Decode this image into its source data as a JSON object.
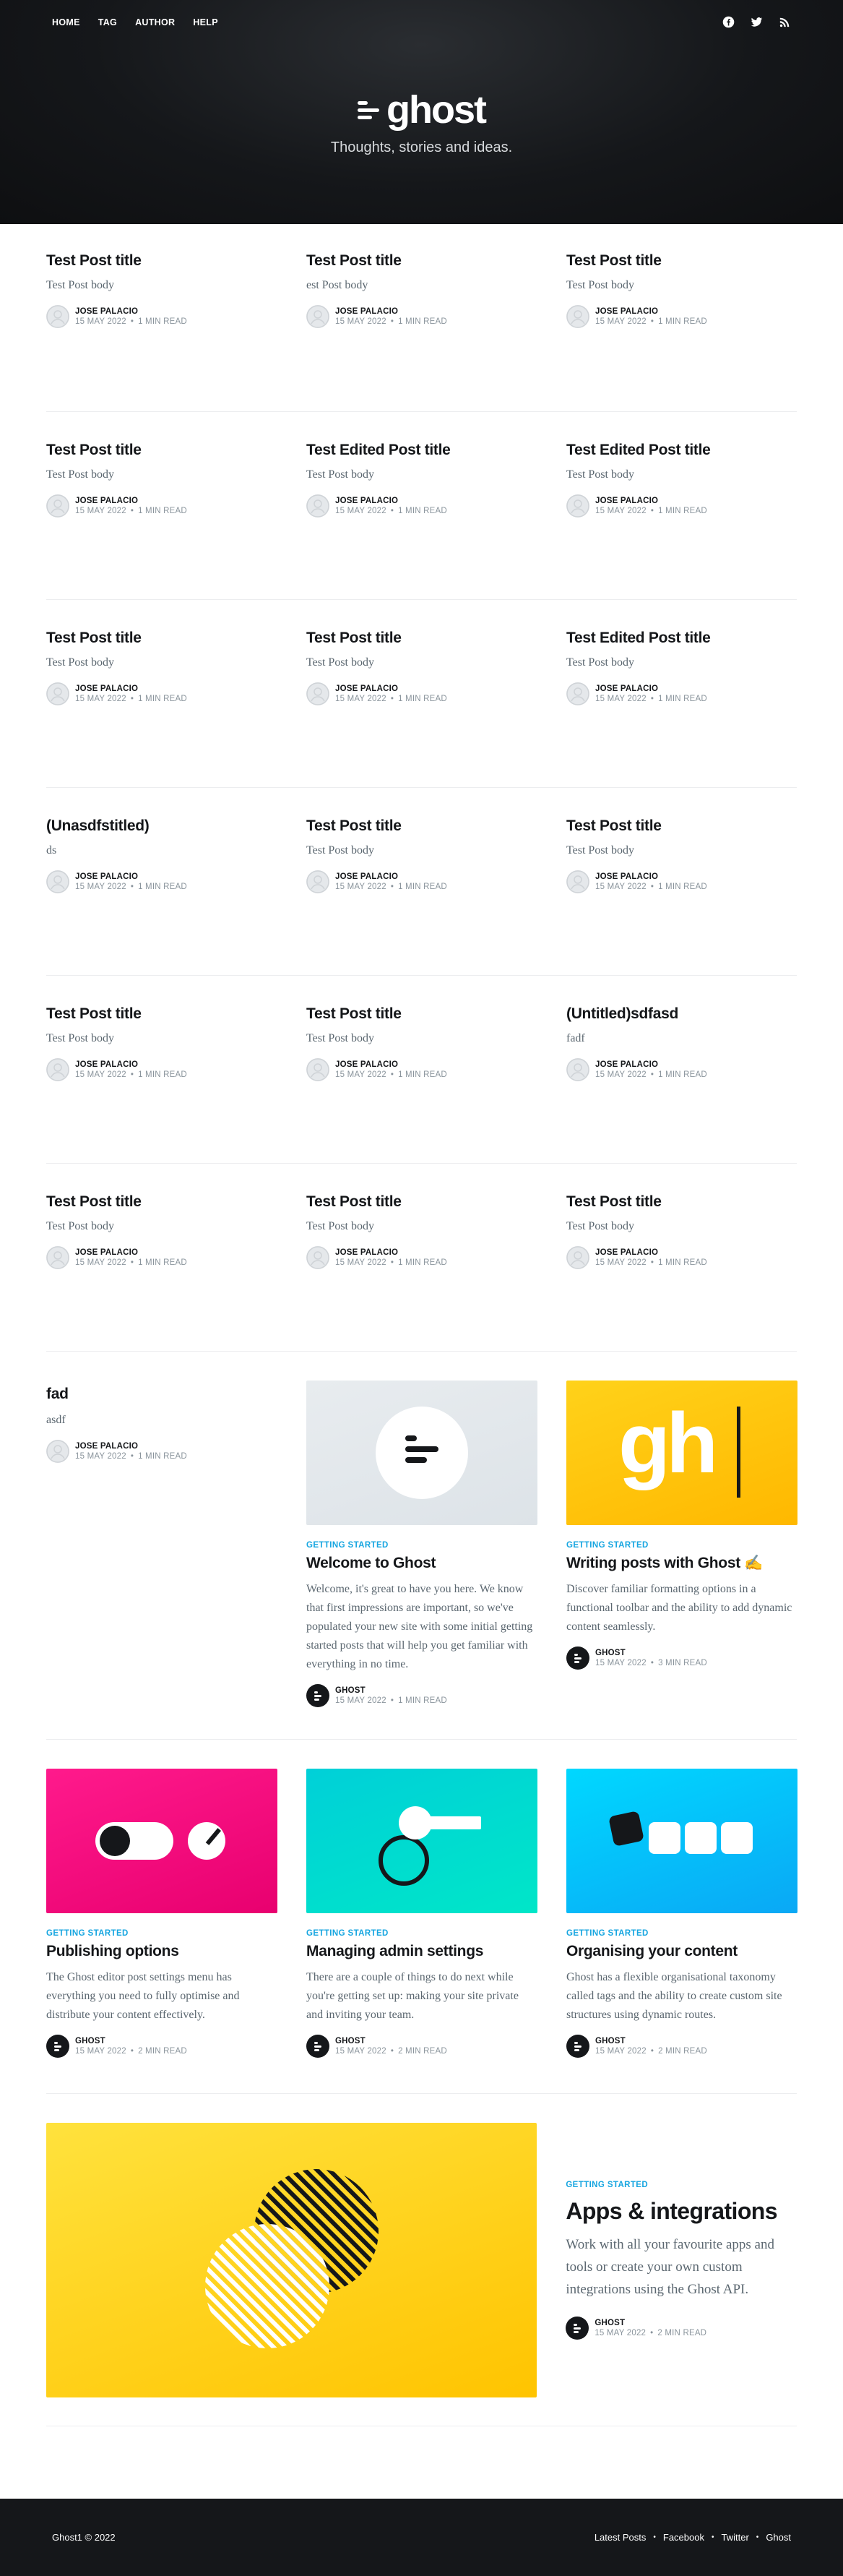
{
  "nav": {
    "links": [
      "HOME",
      "TAG",
      "AUTHOR",
      "HELP"
    ]
  },
  "brand": {
    "name": "ghost",
    "tagline": "Thoughts, stories and ideas."
  },
  "rows": [
    [
      {
        "title": "Test Post title",
        "excerpt": "Test Post body",
        "author": "JOSE PALACIO",
        "date": "15 MAY 2022",
        "read": "1 MIN READ"
      },
      {
        "title": "Test Post title",
        "excerpt": "est Post body",
        "author": "JOSE PALACIO",
        "date": "15 MAY 2022",
        "read": "1 MIN READ"
      },
      {
        "title": "Test Post title",
        "excerpt": "Test Post body",
        "author": "JOSE PALACIO",
        "date": "15 MAY 2022",
        "read": "1 MIN READ"
      }
    ],
    [
      {
        "title": "Test Post title",
        "excerpt": "Test Post body",
        "author": "JOSE PALACIO",
        "date": "15 MAY 2022",
        "read": "1 MIN READ"
      },
      {
        "title": "Test Edited Post title",
        "excerpt": "Test Post body",
        "author": "JOSE PALACIO",
        "date": "15 MAY 2022",
        "read": "1 MIN READ"
      },
      {
        "title": "Test Edited Post title",
        "excerpt": "Test Post body",
        "author": "JOSE PALACIO",
        "date": "15 MAY 2022",
        "read": "1 MIN READ"
      }
    ],
    [
      {
        "title": "Test Post title",
        "excerpt": "Test Post body",
        "author": "JOSE PALACIO",
        "date": "15 MAY 2022",
        "read": "1 MIN READ"
      },
      {
        "title": "Test Post title",
        "excerpt": "Test Post body",
        "author": "JOSE PALACIO",
        "date": "15 MAY 2022",
        "read": "1 MIN READ"
      },
      {
        "title": "Test Edited Post title",
        "excerpt": "Test Post body",
        "author": "JOSE PALACIO",
        "date": "15 MAY 2022",
        "read": "1 MIN READ"
      }
    ],
    [
      {
        "title": "(Unasdfstitled)",
        "excerpt": "ds",
        "author": "JOSE PALACIO",
        "date": "15 MAY 2022",
        "read": "1 MIN READ"
      },
      {
        "title": "Test Post title",
        "excerpt": "Test Post body",
        "author": "JOSE PALACIO",
        "date": "15 MAY 2022",
        "read": "1 MIN READ"
      },
      {
        "title": "Test Post title",
        "excerpt": "Test Post body",
        "author": "JOSE PALACIO",
        "date": "15 MAY 2022",
        "read": "1 MIN READ"
      }
    ],
    [
      {
        "title": "Test Post title",
        "excerpt": "Test Post body",
        "author": "JOSE PALACIO",
        "date": "15 MAY 2022",
        "read": "1 MIN READ"
      },
      {
        "title": "Test Post title",
        "excerpt": "Test Post body",
        "author": "JOSE PALACIO",
        "date": "15 MAY 2022",
        "read": "1 MIN READ"
      },
      {
        "title": "(Untitled)sdfasd",
        "excerpt": "fadf",
        "author": "JOSE PALACIO",
        "date": "15 MAY 2022",
        "read": "1 MIN READ"
      }
    ],
    [
      {
        "title": "Test Post title",
        "excerpt": "Test Post body",
        "author": "JOSE PALACIO",
        "date": "15 MAY 2022",
        "read": "1 MIN READ"
      },
      {
        "title": "Test Post title",
        "excerpt": "Test Post body",
        "author": "JOSE PALACIO",
        "date": "15 MAY 2022",
        "read": "1 MIN READ"
      },
      {
        "title": "Test Post title",
        "excerpt": "Test Post body",
        "author": "JOSE PALACIO",
        "date": "15 MAY 2022",
        "read": "1 MIN READ"
      }
    ]
  ],
  "mixed_row": {
    "text_card": {
      "title": "fad",
      "excerpt": "asdf",
      "author": "JOSE PALACIO",
      "date": "15 MAY 2022",
      "read": "1 MIN READ"
    },
    "welcome": {
      "tag": "GETTING STARTED",
      "title": "Welcome to Ghost",
      "excerpt": "Welcome, it's great to have you here. We know that first impressions are important, so we've populated your new site with some initial getting started posts that will help you get familiar with everything in no time.",
      "author": "GHOST",
      "date": "15 MAY 2022",
      "read": "1 MIN READ"
    },
    "writing": {
      "tag": "GETTING STARTED",
      "title": "Writing posts with Ghost ✍️",
      "excerpt": "Discover familiar formatting options in a functional toolbar and the ability to add dynamic content seamlessly.",
      "author": "GHOST",
      "date": "15 MAY 2022",
      "read": "3 MIN READ",
      "image_text": "gh"
    }
  },
  "image_row": [
    {
      "tag": "GETTING STARTED",
      "title": "Publishing options",
      "excerpt": "The Ghost editor post settings menu has everything you need to fully optimise and distribute your content effectively.",
      "author": "GHOST",
      "date": "15 MAY 2022",
      "read": "2 MIN READ"
    },
    {
      "tag": "GETTING STARTED",
      "title": "Managing admin settings",
      "excerpt": "There are a couple of things to do next while you're getting set up: making your site private and inviting your team.",
      "author": "GHOST",
      "date": "15 MAY 2022",
      "read": "2 MIN READ"
    },
    {
      "tag": "GETTING STARTED",
      "title": "Organising your content",
      "excerpt": "Ghost has a flexible organisational taxonomy called tags and the ability to create custom site structures using dynamic routes.",
      "author": "GHOST",
      "date": "15 MAY 2022",
      "read": "2 MIN READ"
    }
  ],
  "big": {
    "tag": "GETTING STARTED",
    "title": "Apps & integrations",
    "excerpt": "Work with all your favourite apps and tools or create your own custom integrations using the Ghost API.",
    "author": "GHOST",
    "date": "15 MAY 2022",
    "read": "2 MIN READ"
  },
  "footer": {
    "copyright": "Ghost1 © 2022",
    "links": [
      "Latest Posts",
      "Facebook",
      "Twitter",
      "Ghost"
    ]
  },
  "colors": {
    "accent": "#15a5e0",
    "header_bg": "#15171a"
  },
  "icons": [
    "facebook-icon",
    "twitter-icon",
    "rss-icon",
    "avatar-placeholder-icon",
    "ghost-logo-icon"
  ]
}
